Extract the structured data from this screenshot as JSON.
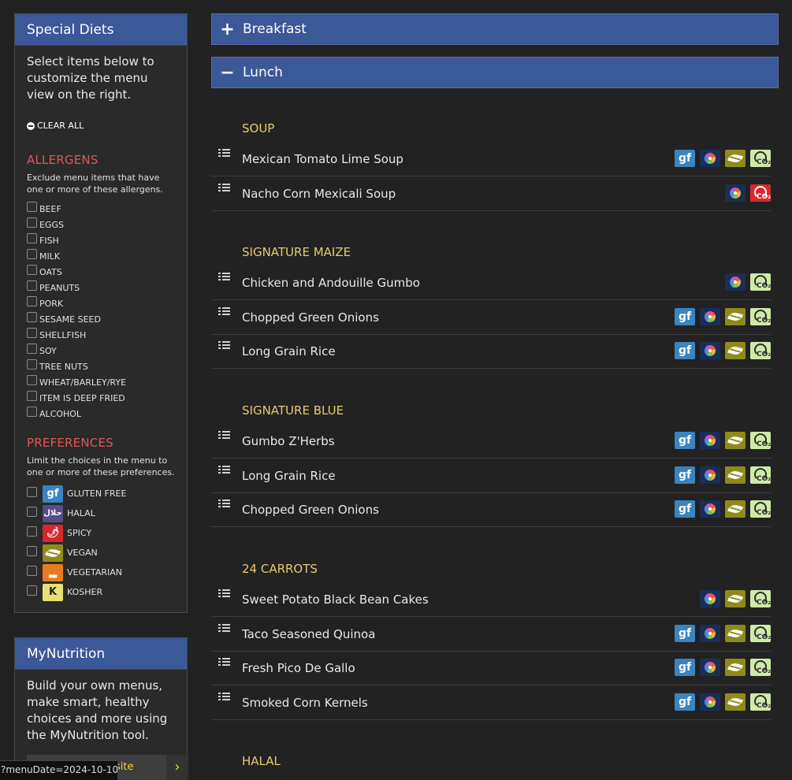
{
  "special_diets": {
    "title": "Special Diets",
    "intro": "Select items below to customize the menu view on the right.",
    "clear_all": "CLEAR ALL",
    "allergens_title": "ALLERGENS",
    "allergens_desc": "Exclude menu items that have one or more of these allergens.",
    "allergens": [
      "BEEF",
      "EGGS",
      "FISH",
      "MILK",
      "OATS",
      "PEANUTS",
      "PORK",
      "SESAME SEED",
      "SHELLFISH",
      "SOY",
      "TREE NUTS",
      "WHEAT/BARLEY/RYE",
      "ITEM IS DEEP FRIED",
      "ALCOHOL"
    ],
    "preferences_title": "PREFERENCES",
    "preferences_desc": "Limit the choices in the menu to one or more of these preferences.",
    "preferences": [
      {
        "label": "GLUTEN FREE",
        "icon": "gluten-free-icon",
        "glyph": "gf",
        "color": "#3a84c0"
      },
      {
        "label": "HALAL",
        "icon": "halal-icon",
        "glyph": "حلال",
        "color": "#5a4a8a"
      },
      {
        "label": "SPICY",
        "icon": "spicy-icon",
        "glyph": "🌶",
        "color": "#d8282c"
      },
      {
        "label": "VEGAN",
        "icon": "vegan-icon",
        "glyph": "",
        "color": "#8f8b1a"
      },
      {
        "label": "VEGETARIAN",
        "icon": "vegetarian-icon",
        "glyph": "",
        "color": "#e87a20"
      },
      {
        "label": "KOSHER",
        "icon": "kosher-icon",
        "glyph": "K",
        "color": "#e8e070"
      }
    ]
  },
  "mynutrition": {
    "title": "MyNutrition",
    "text": "Build your own menus, make smart, healthy choices and more using the MyNutrition tool.",
    "button_label": "site"
  },
  "status_url": "?menuDate=2024-10-10",
  "meals": {
    "breakfast": {
      "label": "Breakfast",
      "symbol": "+"
    },
    "lunch": {
      "label": "Lunch",
      "symbol": "−"
    }
  },
  "stations": [
    {
      "name": "SOUP",
      "items": [
        {
          "name": "Mexican Tomato Lime Soup",
          "badges": [
            "gf",
            "balanced",
            "vegan",
            "co2-low"
          ]
        },
        {
          "name": "Nacho Corn Mexicali Soup",
          "badges": [
            "balanced",
            "co2-high"
          ]
        }
      ]
    },
    {
      "name": "SIGNATURE MAIZE",
      "items": [
        {
          "name": "Chicken and Andouille Gumbo",
          "badges": [
            "balanced",
            "co2-low"
          ]
        },
        {
          "name": "Chopped Green Onions",
          "badges": [
            "gf",
            "balanced",
            "vegan",
            "co2-low"
          ]
        },
        {
          "name": "Long Grain Rice",
          "badges": [
            "gf",
            "balanced",
            "vegan",
            "co2-low"
          ]
        }
      ]
    },
    {
      "name": "SIGNATURE BLUE",
      "items": [
        {
          "name": "Gumbo Z'Herbs",
          "badges": [
            "gf",
            "balanced",
            "vegan",
            "co2-low"
          ]
        },
        {
          "name": "Long Grain Rice",
          "badges": [
            "gf",
            "balanced",
            "vegan",
            "co2-low"
          ]
        },
        {
          "name": "Chopped Green Onions",
          "badges": [
            "gf",
            "balanced",
            "vegan",
            "co2-low"
          ]
        }
      ]
    },
    {
      "name": "24 CARROTS",
      "items": [
        {
          "name": "Sweet Potato Black Bean Cakes",
          "badges": [
            "balanced",
            "vegan",
            "co2-low"
          ]
        },
        {
          "name": "Taco Seasoned Quinoa",
          "badges": [
            "gf",
            "balanced",
            "vegan",
            "co2-low"
          ]
        },
        {
          "name": "Fresh Pico De Gallo",
          "badges": [
            "gf",
            "balanced",
            "vegan",
            "co2-low"
          ]
        },
        {
          "name": "Smoked Corn Kernels",
          "badges": [
            "gf",
            "balanced",
            "vegan",
            "co2-low"
          ]
        }
      ]
    },
    {
      "name": "HALAL",
      "items": []
    }
  ],
  "badge_text": {
    "gf": "gf",
    "co2": "CO₂"
  }
}
